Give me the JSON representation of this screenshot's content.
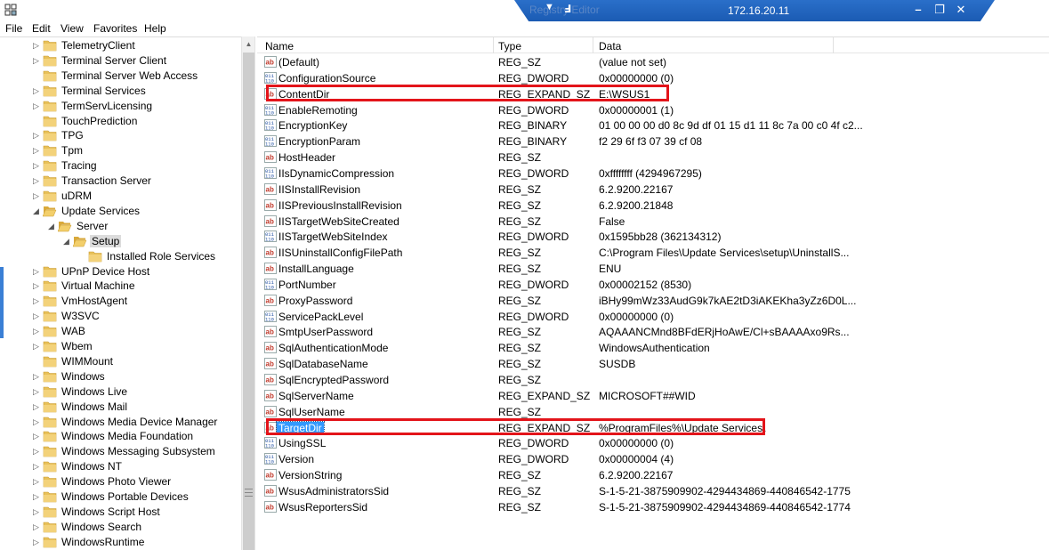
{
  "titlebar": {
    "rdp_ghost_text": "Registry Editor",
    "ip": "172.16.20.11",
    "pin_glyph": "▼",
    "signal_glyph": "Ⅎ",
    "minimize_glyph": "–",
    "restore_glyph": "❐",
    "close_glyph": "✕",
    "accent": "#1b5bb3"
  },
  "menu": [
    "File",
    "Edit",
    "View",
    "Favorites",
    "Help"
  ],
  "tree": [
    {
      "label": "TelemetryClient",
      "depth": 0,
      "expander": "collapsed"
    },
    {
      "label": "Terminal Server Client",
      "depth": 0,
      "expander": "collapsed"
    },
    {
      "label": "Terminal Server Web Access",
      "depth": 0,
      "expander": "none"
    },
    {
      "label": "Terminal Services",
      "depth": 0,
      "expander": "collapsed"
    },
    {
      "label": "TermServLicensing",
      "depth": 0,
      "expander": "collapsed"
    },
    {
      "label": "TouchPrediction",
      "depth": 0,
      "expander": "none"
    },
    {
      "label": "TPG",
      "depth": 0,
      "expander": "collapsed"
    },
    {
      "label": "Tpm",
      "depth": 0,
      "expander": "collapsed"
    },
    {
      "label": "Tracing",
      "depth": 0,
      "expander": "collapsed"
    },
    {
      "label": "Transaction Server",
      "depth": 0,
      "expander": "collapsed"
    },
    {
      "label": "uDRM",
      "depth": 0,
      "expander": "collapsed"
    },
    {
      "label": "Update Services",
      "depth": 0,
      "expander": "expanded"
    },
    {
      "label": "Server",
      "depth": 1,
      "expander": "expanded"
    },
    {
      "label": "Setup",
      "depth": 2,
      "expander": "expanded",
      "selected": true
    },
    {
      "label": "Installed Role Services",
      "depth": 3,
      "expander": "none"
    },
    {
      "label": "UPnP Device Host",
      "depth": 0,
      "expander": "collapsed"
    },
    {
      "label": "Virtual Machine",
      "depth": 0,
      "expander": "collapsed"
    },
    {
      "label": "VmHostAgent",
      "depth": 0,
      "expander": "collapsed"
    },
    {
      "label": "W3SVC",
      "depth": 0,
      "expander": "collapsed"
    },
    {
      "label": "WAB",
      "depth": 0,
      "expander": "collapsed"
    },
    {
      "label": "Wbem",
      "depth": 0,
      "expander": "collapsed"
    },
    {
      "label": "WIMMount",
      "depth": 0,
      "expander": "none"
    },
    {
      "label": "Windows",
      "depth": 0,
      "expander": "collapsed"
    },
    {
      "label": "Windows Live",
      "depth": 0,
      "expander": "collapsed"
    },
    {
      "label": "Windows Mail",
      "depth": 0,
      "expander": "collapsed"
    },
    {
      "label": "Windows Media Device Manager",
      "depth": 0,
      "expander": "collapsed"
    },
    {
      "label": "Windows Media Foundation",
      "depth": 0,
      "expander": "collapsed"
    },
    {
      "label": "Windows Messaging Subsystem",
      "depth": 0,
      "expander": "collapsed"
    },
    {
      "label": "Windows NT",
      "depth": 0,
      "expander": "collapsed"
    },
    {
      "label": "Windows Photo Viewer",
      "depth": 0,
      "expander": "collapsed"
    },
    {
      "label": "Windows Portable Devices",
      "depth": 0,
      "expander": "collapsed"
    },
    {
      "label": "Windows Script Host",
      "depth": 0,
      "expander": "collapsed"
    },
    {
      "label": "Windows Search",
      "depth": 0,
      "expander": "collapsed"
    },
    {
      "label": "WindowsRuntime",
      "depth": 0,
      "expander": "collapsed"
    }
  ],
  "columns": {
    "name": "Name",
    "type": "Type",
    "data": "Data"
  },
  "values": [
    {
      "name": "(Default)",
      "type": "REG_SZ",
      "data": "(value not set)",
      "icon": "string"
    },
    {
      "name": "ConfigurationSource",
      "type": "REG_DWORD",
      "data": "0x00000000 (0)",
      "icon": "binary"
    },
    {
      "name": "ContentDir",
      "type": "REG_EXPAND_SZ",
      "data": "E:\\WSUS1",
      "icon": "string",
      "highlight": true
    },
    {
      "name": "EnableRemoting",
      "type": "REG_DWORD",
      "data": "0x00000001 (1)",
      "icon": "binary"
    },
    {
      "name": "EncryptionKey",
      "type": "REG_BINARY",
      "data": "01 00 00 00 d0 8c 9d df 01 15 d1 11 8c 7a 00 c0 4f c2...",
      "icon": "binary"
    },
    {
      "name": "EncryptionParam",
      "type": "REG_BINARY",
      "data": "f2 29 6f f3 07 39 cf 08",
      "icon": "binary"
    },
    {
      "name": "HostHeader",
      "type": "REG_SZ",
      "data": "",
      "icon": "string"
    },
    {
      "name": "IIsDynamicCompression",
      "type": "REG_DWORD",
      "data": "0xffffffff (4294967295)",
      "icon": "binary"
    },
    {
      "name": "IISInstallRevision",
      "type": "REG_SZ",
      "data": "6.2.9200.22167",
      "icon": "string"
    },
    {
      "name": "IISPreviousInstallRevision",
      "type": "REG_SZ",
      "data": "6.2.9200.21848",
      "icon": "string"
    },
    {
      "name": "IISTargetWebSiteCreated",
      "type": "REG_SZ",
      "data": "False",
      "icon": "string"
    },
    {
      "name": "IISTargetWebSiteIndex",
      "type": "REG_DWORD",
      "data": "0x1595bb28 (362134312)",
      "icon": "binary"
    },
    {
      "name": "IISUninstallConfigFilePath",
      "type": "REG_SZ",
      "data": "C:\\Program Files\\Update Services\\setup\\UninstallS...",
      "icon": "string"
    },
    {
      "name": "InstallLanguage",
      "type": "REG_SZ",
      "data": "ENU",
      "icon": "string"
    },
    {
      "name": "PortNumber",
      "type": "REG_DWORD",
      "data": "0x00002152 (8530)",
      "icon": "binary"
    },
    {
      "name": "ProxyPassword",
      "type": "REG_SZ",
      "data": "iBHy99mWz33AudG9k7kAE2tD3iAKEKha3yZz6D0L...",
      "icon": "string"
    },
    {
      "name": "ServicePackLevel",
      "type": "REG_DWORD",
      "data": "0x00000000 (0)",
      "icon": "binary"
    },
    {
      "name": "SmtpUserPassword",
      "type": "REG_SZ",
      "data": "AQAAANCMnd8BFdERjHoAwE/Cl+sBAAAAxo9Rs...",
      "icon": "string"
    },
    {
      "name": "SqlAuthenticationMode",
      "type": "REG_SZ",
      "data": "WindowsAuthentication",
      "icon": "string"
    },
    {
      "name": "SqlDatabaseName",
      "type": "REG_SZ",
      "data": "SUSDB",
      "icon": "string"
    },
    {
      "name": "SqlEncryptedPassword",
      "type": "REG_SZ",
      "data": "",
      "icon": "string"
    },
    {
      "name": "SqlServerName",
      "type": "REG_EXPAND_SZ",
      "data": "MICROSOFT##WID",
      "icon": "string"
    },
    {
      "name": "SqlUserName",
      "type": "REG_SZ",
      "data": "",
      "icon": "string"
    },
    {
      "name": "TargetDir",
      "type": "REG_EXPAND_SZ",
      "data": "%ProgramFiles%\\Update Services\\",
      "icon": "string",
      "highlight": true,
      "selected": true
    },
    {
      "name": "UsingSSL",
      "type": "REG_DWORD",
      "data": "0x00000000 (0)",
      "icon": "binary"
    },
    {
      "name": "Version",
      "type": "REG_DWORD",
      "data": "0x00000004 (4)",
      "icon": "binary"
    },
    {
      "name": "VersionString",
      "type": "REG_SZ",
      "data": "6.2.9200.22167",
      "icon": "string"
    },
    {
      "name": "WsusAdministratorsSid",
      "type": "REG_SZ",
      "data": "S-1-5-21-3875909902-4294434869-440846542-1775",
      "icon": "string"
    },
    {
      "name": "WsusReportersSid",
      "type": "REG_SZ",
      "data": "S-1-5-21-3875909902-4294434869-440846542-1774",
      "icon": "string"
    }
  ],
  "colors": {
    "highlight_box": "#e3141a",
    "selection": "#3399ff",
    "folder": "#e8c15a"
  }
}
